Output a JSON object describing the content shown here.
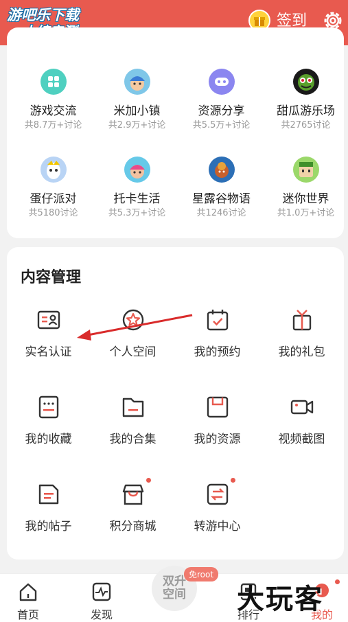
{
  "header": {
    "watermark_line1": "游吧乐下载",
    "watermark_line2": "小编亲测",
    "signin_label": "签到",
    "accent": "#e85a4f"
  },
  "games": [
    {
      "name": "游戏交流",
      "count": "共8.7万+讨论"
    },
    {
      "name": "米加小镇",
      "count": "共2.9万+讨论"
    },
    {
      "name": "资源分享",
      "count": "共5.5万+讨论"
    },
    {
      "name": "甜瓜游乐场",
      "count": "共2765讨论"
    },
    {
      "name": "蛋仔派对",
      "count": "共5180讨论"
    },
    {
      "name": "托卡生活",
      "count": "共5.3万+讨论"
    },
    {
      "name": "星露谷物语",
      "count": "共1246讨论"
    },
    {
      "name": "迷你世界",
      "count": "共1.0万+讨论"
    }
  ],
  "content": {
    "title": "内容管理",
    "items": [
      {
        "label": "实名认证",
        "icon": "id-card-icon"
      },
      {
        "label": "个人空间",
        "icon": "star-badge-icon"
      },
      {
        "label": "我的预约",
        "icon": "calendar-check-icon"
      },
      {
        "label": "我的礼包",
        "icon": "gift-box-icon"
      },
      {
        "label": "我的收藏",
        "icon": "bookmark-list-icon"
      },
      {
        "label": "我的合集",
        "icon": "folder-icon"
      },
      {
        "label": "我的资源",
        "icon": "save-icon"
      },
      {
        "label": "视频截图",
        "icon": "video-camera-icon"
      },
      {
        "label": "我的帖子",
        "icon": "post-icon"
      },
      {
        "label": "积分商城",
        "icon": "shop-icon"
      },
      {
        "label": "转游中心",
        "icon": "transfer-icon"
      }
    ]
  },
  "tabbar": {
    "home": "首页",
    "discover": "发现",
    "center_line1": "双升",
    "center_line2": "空间",
    "root_badge": "免root",
    "rank": "排行",
    "mine": "我的"
  },
  "overlay_watermark": "大玩客"
}
